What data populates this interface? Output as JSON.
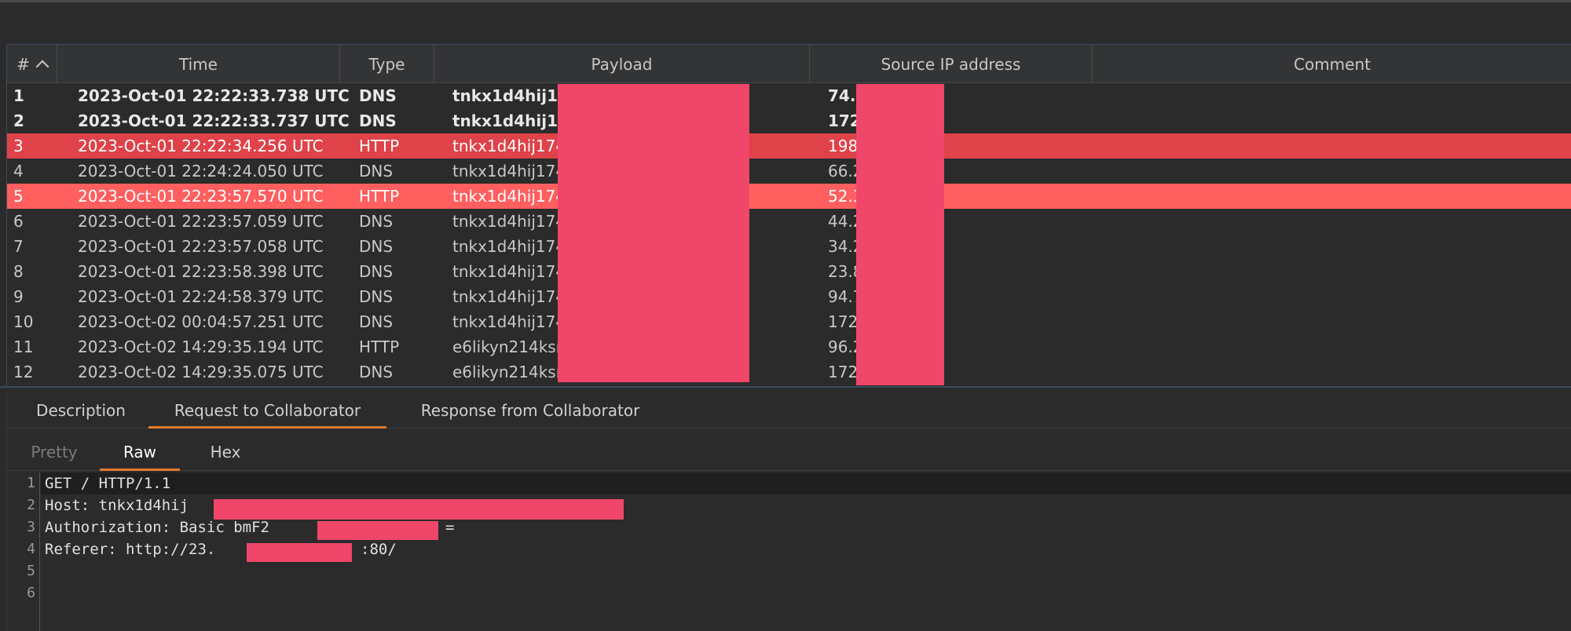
{
  "table": {
    "columns": [
      {
        "key": "num",
        "label": "#"
      },
      {
        "key": "time",
        "label": "Time"
      },
      {
        "key": "type",
        "label": "Type"
      },
      {
        "key": "payload",
        "label": "Payload"
      },
      {
        "key": "source_ip",
        "label": "Source IP address"
      },
      {
        "key": "comment",
        "label": "Comment"
      }
    ],
    "sort_icon": "chevron-up-icon",
    "rows": [
      {
        "num": "1",
        "time": "2023-Oct-01 22:22:33.738 UTC",
        "type": "DNS",
        "payload": "tnkx1d4hij174",
        "source_ip": "74.1",
        "style": "bold"
      },
      {
        "num": "2",
        "time": "2023-Oct-01 22:22:33.737 UTC",
        "type": "DNS",
        "payload": "tnkx1d4hij174",
        "source_ip": "172.",
        "style": "bold"
      },
      {
        "num": "3",
        "time": "2023-Oct-01 22:22:34.256 UTC",
        "type": "HTTP",
        "payload": "tnkx1d4hij174",
        "source_ip": "198.",
        "style": "hl-red"
      },
      {
        "num": "4",
        "time": "2023-Oct-01 22:24:24.050 UTC",
        "type": "DNS",
        "payload": "tnkx1d4hij174",
        "source_ip": "66.2",
        "style": ""
      },
      {
        "num": "5",
        "time": "2023-Oct-01 22:23:57.570 UTC",
        "type": "HTTP",
        "payload": "tnkx1d4hij174",
        "source_ip": "52.3",
        "style": "hl-salmon"
      },
      {
        "num": "6",
        "time": "2023-Oct-01 22:23:57.059 UTC",
        "type": "DNS",
        "payload": "tnkx1d4hij174",
        "source_ip": "44.2",
        "style": ""
      },
      {
        "num": "7",
        "time": "2023-Oct-01 22:23:57.058 UTC",
        "type": "DNS",
        "payload": "tnkx1d4hij174",
        "source_ip": "34.2",
        "style": ""
      },
      {
        "num": "8",
        "time": "2023-Oct-01 22:23:58.398 UTC",
        "type": "DNS",
        "payload": "tnkx1d4hij174",
        "source_ip": "23.8",
        "style": ""
      },
      {
        "num": "9",
        "time": "2023-Oct-01 22:24:58.379 UTC",
        "type": "DNS",
        "payload": "tnkx1d4hij174",
        "source_ip": "94.7",
        "style": ""
      },
      {
        "num": "10",
        "time": "2023-Oct-02 00:04:57.251 UTC",
        "type": "DNS",
        "payload": "tnkx1d4hij174",
        "source_ip": "172.",
        "style": ""
      },
      {
        "num": "11",
        "time": "2023-Oct-02 14:29:35.194 UTC",
        "type": "HTTP",
        "payload": "e6likyn214ksr",
        "source_ip": "96.2",
        "style": ""
      },
      {
        "num": "12",
        "time": "2023-Oct-02 14:29:35.075 UTC",
        "type": "DNS",
        "payload": "e6likyn214ksr",
        "source_ip": "172.",
        "style": ""
      }
    ]
  },
  "detail_tabs": [
    {
      "label": "Description"
    },
    {
      "label": "Request to Collaborator"
    },
    {
      "label": "Response from Collaborator"
    }
  ],
  "view_tabs": [
    {
      "label": "Pretty"
    },
    {
      "label": "Raw"
    },
    {
      "label": "Hex"
    }
  ],
  "request_lines": [
    {
      "n": "1",
      "text": "GET / HTTP/1.1"
    },
    {
      "n": "2",
      "text": "Host: tnkx1d4hij"
    },
    {
      "n": "3",
      "text": "Authorization: Basic bmF2"
    },
    {
      "n": "4",
      "text": "Referer: http://23."
    },
    {
      "n": "5",
      "text": ""
    },
    {
      "n": "6",
      "text": ""
    }
  ],
  "request_line_tails": {
    "auth_tail": "=",
    "referer_tail": ":80/"
  },
  "colors": {
    "accent_tab": "#e57a2d",
    "row_highlight_red": "#df4249",
    "row_highlight_salmon": "#ff5f5f",
    "redaction": "#f0466a"
  }
}
